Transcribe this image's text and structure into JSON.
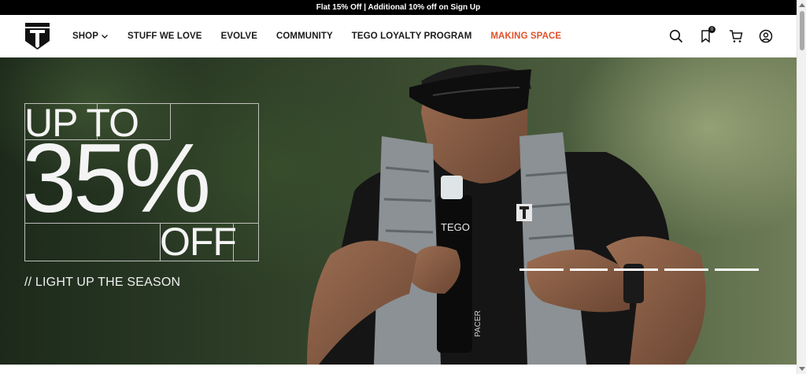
{
  "announcement": {
    "text": "Flat 15% Off | Additional 10% off on Sign Up"
  },
  "nav": {
    "items": [
      {
        "label": "SHOP",
        "has_dropdown": true
      },
      {
        "label": "STUFF WE LOVE"
      },
      {
        "label": "EVOLVE"
      },
      {
        "label": "COMMUNITY"
      },
      {
        "label": "TEGO LOYALTY PROGRAM"
      },
      {
        "label": "MAKING SPACE",
        "accent": "#e0522b"
      }
    ]
  },
  "header_icons": {
    "search": "search-icon",
    "wishlist": "bookmark-icon",
    "wishlist_count": "0",
    "cart": "cart-icon",
    "account": "account-icon"
  },
  "hero": {
    "line1": "UP TO",
    "line2": "35%",
    "line3": "OFF",
    "tagline": "// LIGHT UP THE SEASON",
    "bottle_brand": "TEGO",
    "bottle_label": "PACER",
    "slide_count": 5
  },
  "colors": {
    "accent": "#e0522b",
    "announcement_bg": "#000000"
  }
}
